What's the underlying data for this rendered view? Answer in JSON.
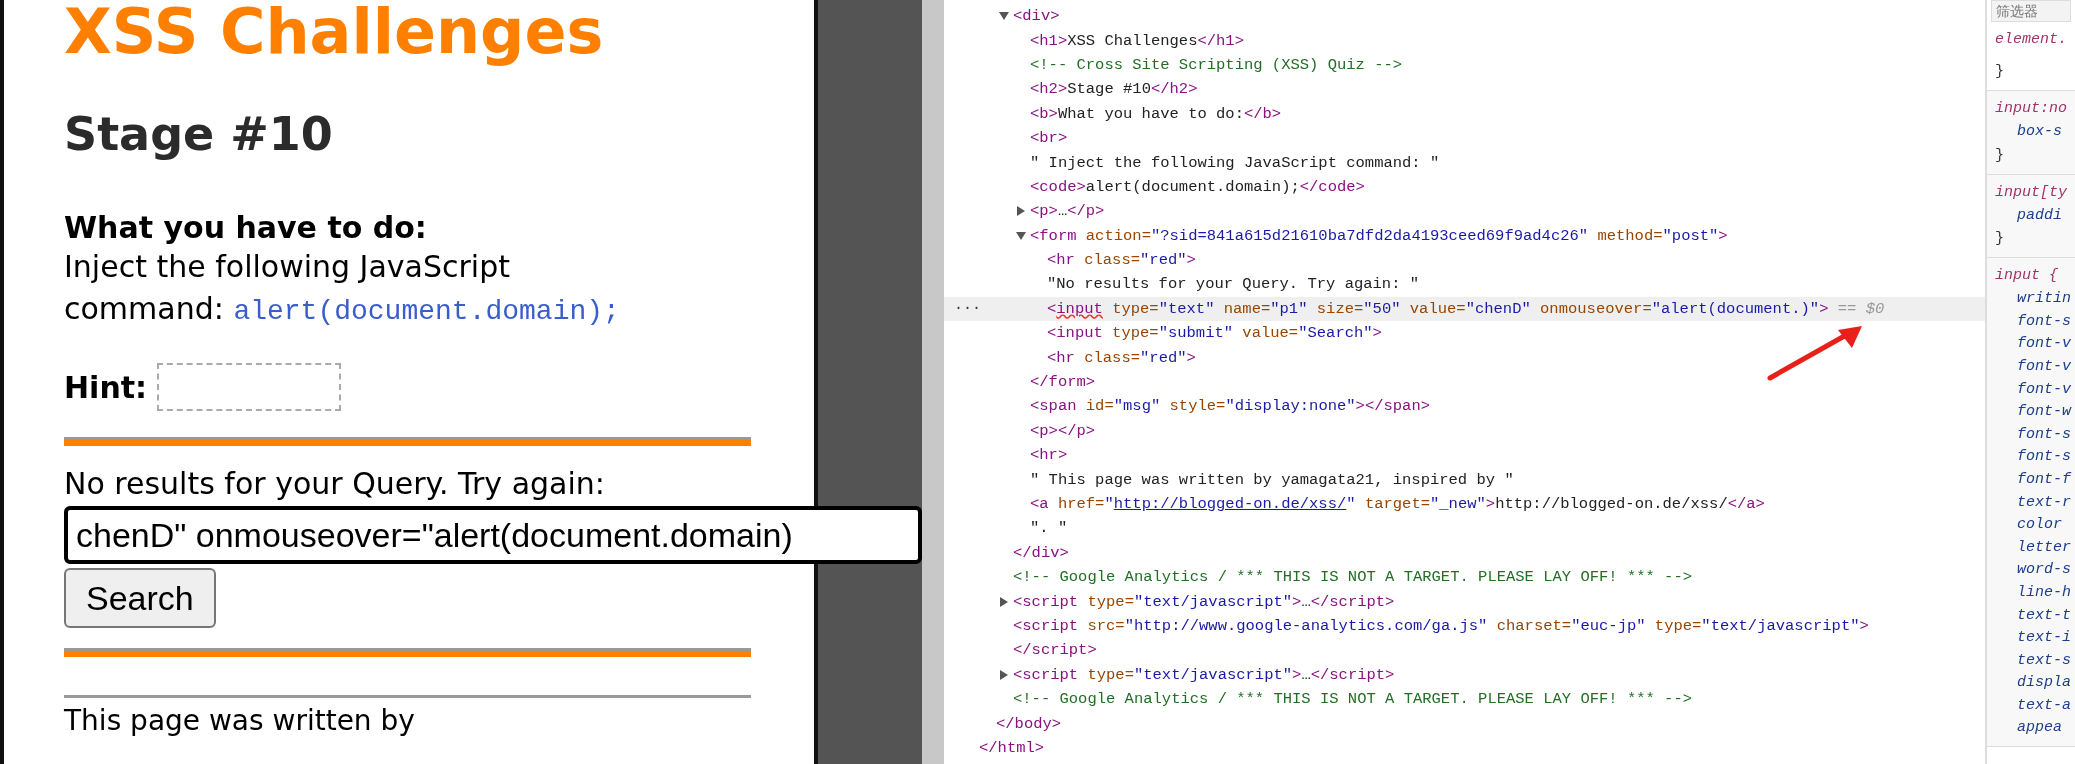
{
  "page": {
    "title": "XSS Challenges",
    "stage": "Stage #10",
    "task_label": "What you have to do:",
    "instruction": "Inject the following JavaScript command:",
    "command": "alert(document.domain);",
    "hint_label": "Hint:",
    "result_text": "No results for your Query. Try again:",
    "query_field": {
      "value": "chenD\" onmouseover=\"alert(document.domain)"
    },
    "search_button": "Search",
    "footer_text": "This page was written by"
  },
  "elements_panel": {
    "selection_marker": "···",
    "nodes": [
      {
        "close": [
          {
            "kind": "tag",
            "text": "</html>"
          }
        ],
        "children": [
          {
            "close": [
              {
                "kind": "tag",
                "text": "</body>"
              }
            ],
            "children": [
              {
                "expanded": true,
                "selected": false,
                "open": [
                  {
                    "kind": "tag",
                    "text": "<div>"
                  }
                ],
                "close": [
                  {
                    "kind": "tag",
                    "text": "</div>"
                  }
                ],
                "children": [
                  {
                    "selected": false,
                    "open": [
                      {
                        "kind": "tag",
                        "text": "<h1>"
                      },
                      {
                        "kind": "text",
                        "text": "XSS Challenges"
                      },
                      {
                        "kind": "tag",
                        "text": "</h1>"
                      }
                    ]
                  },
                  {
                    "selected": false,
                    "open": [
                      {
                        "kind": "comment",
                        "text": "<!-- Cross Site Scripting (XSS) Quiz -->"
                      }
                    ]
                  },
                  {
                    "selected": false,
                    "open": [
                      {
                        "kind": "tag",
                        "text": "<h2>"
                      },
                      {
                        "kind": "text",
                        "text": "Stage #10"
                      },
                      {
                        "kind": "tag",
                        "text": "</h2>"
                      }
                    ]
                  },
                  {
                    "selected": false,
                    "open": [
                      {
                        "kind": "tag",
                        "text": "<b>"
                      },
                      {
                        "kind": "text",
                        "text": "What you have to do:"
                      },
                      {
                        "kind": "tag",
                        "text": "</b>"
                      }
                    ]
                  },
                  {
                    "selected": false,
                    "open": [
                      {
                        "kind": "tag",
                        "text": "<br>"
                      }
                    ]
                  },
                  {
                    "selected": false,
                    "open": [
                      {
                        "kind": "text",
                        "text": "\" Inject the following JavaScript command: \""
                      }
                    ]
                  },
                  {
                    "selected": false,
                    "open": [
                      {
                        "kind": "tag",
                        "text": "<code>"
                      },
                      {
                        "kind": "text",
                        "text": "alert(document.domain);"
                      },
                      {
                        "kind": "tag",
                        "text": "</code>"
                      }
                    ]
                  },
                  {
                    "expanded": false,
                    "selected": false,
                    "open": [
                      {
                        "kind": "tag",
                        "text": "<p>"
                      },
                      {
                        "kind": "text",
                        "text": "…"
                      },
                      {
                        "kind": "tag",
                        "text": "</p>"
                      }
                    ]
                  },
                  {
                    "expanded": true,
                    "selected": false,
                    "open": [
                      {
                        "kind": "tag",
                        "text": "<form"
                      },
                      {
                        "kind": "attr",
                        "text": " action="
                      },
                      {
                        "kind": "value",
                        "text": "\"?sid=841a615d21610ba7dfd2da4193ceed69f9ad4c26\""
                      },
                      {
                        "kind": "attr",
                        "text": " method="
                      },
                      {
                        "kind": "value",
                        "text": "\"post\""
                      },
                      {
                        "kind": "tag",
                        "text": ">"
                      }
                    ],
                    "close": [
                      {
                        "kind": "tag",
                        "text": "</form>"
                      }
                    ],
                    "children": [
                      {
                        "selected": false,
                        "open": [
                          {
                            "kind": "tag",
                            "text": "<hr"
                          },
                          {
                            "kind": "attr",
                            "text": " class="
                          },
                          {
                            "kind": "value",
                            "text": "\"red\""
                          },
                          {
                            "kind": "tag",
                            "text": ">"
                          }
                        ]
                      },
                      {
                        "selected": false,
                        "open": [
                          {
                            "kind": "text",
                            "text": "\"No results for your Query. Try again: \""
                          }
                        ]
                      },
                      {
                        "selected": true,
                        "open": [
                          {
                            "kind": "tag",
                            "text": "<"
                          },
                          {
                            "kind": "flagged",
                            "text": "input"
                          },
                          {
                            "kind": "attr",
                            "text": " type="
                          },
                          {
                            "kind": "value",
                            "text": "\"text\""
                          },
                          {
                            "kind": "attr",
                            "text": " name="
                          },
                          {
                            "kind": "value",
                            "text": "\"p1\""
                          },
                          {
                            "kind": "attr",
                            "text": " size="
                          },
                          {
                            "kind": "value",
                            "text": "\"50\""
                          },
                          {
                            "kind": "attr",
                            "text": " value="
                          },
                          {
                            "kind": "value",
                            "text": "\"chenD\""
                          },
                          {
                            "kind": "attr",
                            "text": " onmouseover="
                          },
                          {
                            "kind": "value",
                            "text": "\"alert(document.)\""
                          },
                          {
                            "kind": "tag",
                            "text": ">"
                          },
                          {
                            "kind": "hint",
                            "text": " == $0"
                          }
                        ]
                      },
                      {
                        "selected": false,
                        "open": [
                          {
                            "kind": "tag",
                            "text": "<input"
                          },
                          {
                            "kind": "attr",
                            "text": " type="
                          },
                          {
                            "kind": "value",
                            "text": "\"submit\""
                          },
                          {
                            "kind": "attr",
                            "text": " value="
                          },
                          {
                            "kind": "value",
                            "text": "\"Search\""
                          },
                          {
                            "kind": "tag",
                            "text": ">"
                          }
                        ]
                      },
                      {
                        "selected": false,
                        "open": [
                          {
                            "kind": "tag",
                            "text": "<hr"
                          },
                          {
                            "kind": "attr",
                            "text": " class="
                          },
                          {
                            "kind": "value",
                            "text": "\"red\""
                          },
                          {
                            "kind": "tag",
                            "text": ">"
                          }
                        ]
                      }
                    ]
                  },
                  {
                    "selected": false,
                    "open": [
                      {
                        "kind": "tag",
                        "text": "<span"
                      },
                      {
                        "kind": "attr",
                        "text": " id="
                      },
                      {
                        "kind": "value",
                        "text": "\"msg\""
                      },
                      {
                        "kind": "attr",
                        "text": " style="
                      },
                      {
                        "kind": "value",
                        "text": "\"display:none\""
                      },
                      {
                        "kind": "tag",
                        "text": "></span>"
                      }
                    ]
                  },
                  {
                    "selected": false,
                    "open": [
                      {
                        "kind": "tag",
                        "text": "<p></p>"
                      }
                    ]
                  },
                  {
                    "selected": false,
                    "open": [
                      {
                        "kind": "tag",
                        "text": "<hr>"
                      }
                    ]
                  },
                  {
                    "selected": false,
                    "open": [
                      {
                        "kind": "text",
                        "text": "\" This page was written by yamagata21, inspired by \""
                      }
                    ]
                  },
                  {
                    "selected": false,
                    "open": [
                      {
                        "kind": "tag",
                        "text": "<a"
                      },
                      {
                        "kind": "attr",
                        "text": " href="
                      },
                      {
                        "kind": "value",
                        "text": "\""
                      },
                      {
                        "kind": "link",
                        "text": "http://blogged-on.de/xss/"
                      },
                      {
                        "kind": "value",
                        "text": "\""
                      },
                      {
                        "kind": "attr",
                        "text": " target="
                      },
                      {
                        "kind": "value",
                        "text": "\"_new\""
                      },
                      {
                        "kind": "tag",
                        "text": ">"
                      },
                      {
                        "kind": "text",
                        "text": "http://blogged-on.de/xss/"
                      },
                      {
                        "kind": "tag",
                        "text": "</a>"
                      }
                    ]
                  },
                  {
                    "selected": false,
                    "open": [
                      {
                        "kind": "text",
                        "text": "\". \""
                      }
                    ]
                  }
                ]
              },
              {
                "selected": false,
                "open": [
                  {
                    "kind": "comment",
                    "text": "<!-- Google Analytics / *** THIS IS NOT A TARGET. PLEASE LAY OFF! *** -->"
                  }
                ]
              },
              {
                "expanded": false,
                "selected": false,
                "open": [
                  {
                    "kind": "tag",
                    "text": "<script"
                  },
                  {
                    "kind": "attr",
                    "text": " type="
                  },
                  {
                    "kind": "value",
                    "text": "\"text/javascript\""
                  },
                  {
                    "kind": "tag",
                    "text": ">"
                  },
                  {
                    "kind": "text",
                    "text": "…"
                  },
                  {
                    "kind": "tag",
                    "text": "</script>"
                  }
                ]
              },
              {
                "selected": false,
                "open": [
                  {
                    "kind": "tag",
                    "text": "<script"
                  },
                  {
                    "kind": "attr",
                    "text": " src="
                  },
                  {
                    "kind": "value",
                    "text": "\"http://www.google-analytics.com/ga.js\""
                  },
                  {
                    "kind": "attr",
                    "text": " charset="
                  },
                  {
                    "kind": "value",
                    "text": "\"euc-jp\""
                  },
                  {
                    "kind": "attr",
                    "text": " type="
                  },
                  {
                    "kind": "value",
                    "text": "\"text/javascript\""
                  },
                  {
                    "kind": "tag",
                    "text": ">"
                  }
                ],
                "close": [
                  {
                    "kind": "tag",
                    "text": "</script>"
                  }
                ]
              },
              {
                "expanded": false,
                "selected": false,
                "open": [
                  {
                    "kind": "tag",
                    "text": "<script"
                  },
                  {
                    "kind": "attr",
                    "text": " type="
                  },
                  {
                    "kind": "value",
                    "text": "\"text/javascript\""
                  },
                  {
                    "kind": "tag",
                    "text": ">"
                  },
                  {
                    "kind": "text",
                    "text": "…"
                  },
                  {
                    "kind": "tag",
                    "text": "</script>"
                  }
                ]
              },
              {
                "selected": false,
                "open": [
                  {
                    "kind": "comment",
                    "text": "<!-- Google Analytics / *** THIS IS NOT A TARGET. PLEASE LAY OFF! *** -->"
                  }
                ]
              }
            ]
          }
        ]
      }
    ]
  },
  "styles_panel": {
    "filter_placeholder": "筛选器",
    "rules": [
      {
        "selector": "element.",
        "close": "}"
      },
      {
        "selector": "input:no",
        "declarations": [
          "box-s"
        ],
        "close": "}"
      },
      {
        "selector": "input[ty",
        "declarations": [
          "paddi"
        ],
        "close": "}"
      },
      {
        "selector": "input {",
        "declarations": [
          "writin",
          "font-s",
          "font-v",
          "font-v",
          "font-v",
          "font-w",
          "font-s",
          "font-s",
          "font-f",
          "text-r",
          "color",
          "letter",
          "word-s",
          "line-h",
          "text-t",
          "text-i",
          "text-s",
          "displa",
          "text-a",
          "appea"
        ]
      }
    ]
  }
}
